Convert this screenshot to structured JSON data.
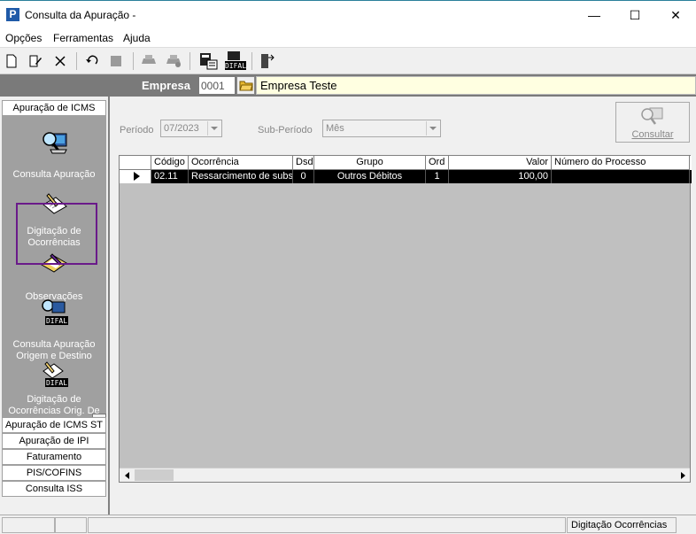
{
  "window": {
    "icon_letter": "P",
    "title": "Consulta da Apuração -",
    "controls": {
      "minimize": "—",
      "maximize": "☐",
      "close": "✕"
    }
  },
  "menu": {
    "items": [
      "Opções",
      "Ferramentas",
      "Ajuda"
    ]
  },
  "toolbar": {
    "icons": [
      "new-icon",
      "edit-icon",
      "delete-icon",
      "undo-icon",
      "save-icon",
      "print-icon",
      "print-preview-icon",
      "calculator-icon",
      "difal-icon",
      "exit-door-icon"
    ],
    "difal_label": "DIFAL"
  },
  "empresa": {
    "label": "Empresa",
    "code": "0001",
    "name": "Empresa Teste"
  },
  "sidebar": {
    "groups": [
      "Apuração de ICMS",
      "Apuração de ICMS ST",
      "Apuração de IPI",
      "Faturamento",
      "PIS/COFINS",
      "Consulta ISS"
    ],
    "items": [
      {
        "label": "Consulta Apuração",
        "icon": "magnifier-computer-icon"
      },
      {
        "label": "Digitação de Ocorrências",
        "icon": "writing-pen-icon"
      },
      {
        "label": "Observações",
        "icon": "notebook-pen-icon"
      },
      {
        "label": "Consulta Apuração Origem e Destino",
        "icon": "difal-magnifier-icon"
      },
      {
        "label": "Digitação de Ocorrências Orig. De",
        "icon": "difal-writing-icon"
      }
    ]
  },
  "filters": {
    "periodo_label": "Período",
    "periodo_value": "07/2023",
    "subperiodo_label": "Sub-Período",
    "subperiodo_value": "Mês",
    "consultar_label": "Consultar"
  },
  "grid": {
    "columns": [
      "Código",
      "Ocorrência",
      "Dsd",
      "Grupo",
      "Ord",
      "Valor",
      "Número do Processo"
    ],
    "rows": [
      {
        "codigo": "02.11",
        "ocorrencia": "Ressarcimento de subst",
        "dsd": "0",
        "grupo": "Outros Débitos",
        "ord": "1",
        "valor": "100,00",
        "processo": ""
      }
    ]
  },
  "status": {
    "text": "Digitação Ocorrências"
  },
  "colors": {
    "accent_border": "#6a1a8a",
    "empresa_bg": "#ffffe1",
    "sidebar_panel": "#a0a0a0"
  }
}
